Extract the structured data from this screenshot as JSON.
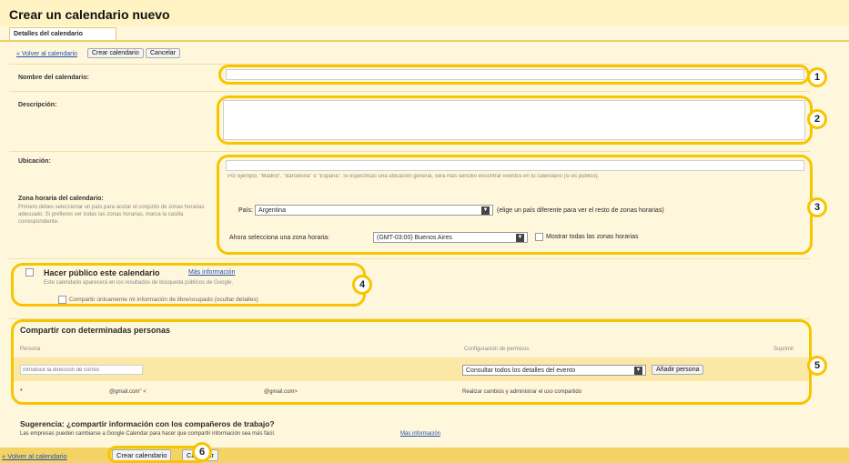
{
  "header": {
    "title": "Crear un calendario nuevo",
    "tab": "Detalles del calendario"
  },
  "top_actions": {
    "back_link": "« Volver al calendario",
    "create_button": "Crear calendario",
    "cancel_button": "Cancelar"
  },
  "form": {
    "name_label": "Nombre del calendario:",
    "name_value": "",
    "description_label": "Descripción:",
    "description_value": "",
    "location_label": "Ubicación:",
    "location_hint": "Por ejemplo, \"Madrid\", \"Barcelona\" o \"España\". Si especificas una ubicación general, será más sencillo encontrar eventos en tu calendario (si es público).",
    "timezone_label": "Zona horaria del calendario:",
    "timezone_desc": "Primero debes seleccionar un país para acotar el conjunto de zonas horarias adecuado. Si prefieres ver todas las zonas horarias, marca la casilla correspondiente.",
    "country_label": "País:",
    "country_value": "Argentina",
    "country_hint": "(elige un país diferente para ver el resto de zonas horarias)",
    "tz_select_label": "Ahora selecciona una zona horaria:",
    "tz_value": "(GMT-03:00) Buenos Aires",
    "show_all_tz": "Mostrar todas las zonas horarias"
  },
  "public": {
    "label": "Hacer público este calendario",
    "more_info": "Más información",
    "desc": "Este calendario aparecerá en los resultados de búsqueda públicos de Google.",
    "freebusy": "Compartir únicamente mi información de libre/ocupado (ocultar detalles)"
  },
  "share": {
    "title": "Compartir con determinadas personas",
    "col_person": "Persona",
    "col_permission": "Configuración de permisos",
    "col_remove": "Suprimir",
    "person_placeholder": "Introduce la dirección de correo",
    "permission_value": "Consultar todos los detalles del evento",
    "add_button": "Añadir persona",
    "row": {
      "asterisk": "*",
      "email_a": "@gmail.com\" <",
      "email_b": "@gmail.com>",
      "permission": "Realizar cambios y administrar el uso compartido"
    }
  },
  "suggestion": {
    "title": "Sugerencia: ¿compartir información con los compañeros de trabajo?",
    "text": "Las empresas pueden cambiarse a Google Calendar para hacer que compartir información sea más fácil.",
    "link": "Más información"
  },
  "bottom_actions": {
    "back_link": "« Volver al calendario",
    "create_button": "Crear calendario",
    "cancel_button": "Cancelar"
  },
  "badges": [
    "1",
    "2",
    "3",
    "4",
    "5",
    "6"
  ],
  "colors": {
    "callout": "#f7c500",
    "background": "#fff7dc",
    "link": "#2050b0"
  }
}
